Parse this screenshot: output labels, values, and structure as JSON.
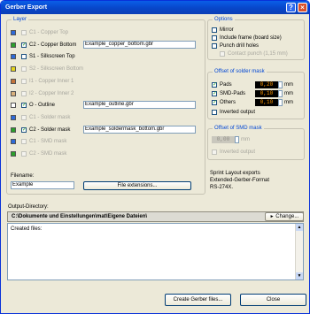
{
  "window": {
    "title": "Gerber Export"
  },
  "layer_group": {
    "label": "Layer",
    "layers": [
      {
        "color": "#2e6ad8",
        "name": "C1 - Copper Top",
        "checked": false,
        "enabled": false,
        "file": ""
      },
      {
        "color": "#2c9f2c",
        "name": "C2 - Copper Bottom",
        "checked": true,
        "enabled": true,
        "file": "Example_copper_bottom.gbr"
      },
      {
        "color": "#2e6ad8",
        "name": "S1 - Silkscreen Top",
        "checked": false,
        "enabled": true,
        "file": ""
      },
      {
        "color": "#e4d41c",
        "name": "S2 - Silkscreen Bottom",
        "checked": false,
        "enabled": false,
        "file": ""
      },
      {
        "color": "#c3733a",
        "name": "I1 - Copper Inner 1",
        "checked": false,
        "enabled": false,
        "file": ""
      },
      {
        "color": "#d8b07c",
        "name": "I2 - Copper Inner 2",
        "checked": false,
        "enabled": false,
        "file": ""
      },
      {
        "color": "#ffffff",
        "name": "O - Outline",
        "checked": true,
        "enabled": true,
        "file": "Example_outline.gbr"
      },
      {
        "color": "#2e6ad8",
        "name": "C1 - Solder mask",
        "checked": false,
        "enabled": false,
        "file": ""
      },
      {
        "color": "#2c9f2c",
        "name": "C2 - Solder mask",
        "checked": true,
        "enabled": true,
        "file": "Example_soldermask_bottom.gbr"
      },
      {
        "color": "#2e6ad8",
        "name": "C1 - SMD mask",
        "checked": false,
        "enabled": false,
        "file": ""
      },
      {
        "color": "#2c9f2c",
        "name": "C2 - SMD mask",
        "checked": false,
        "enabled": false,
        "file": ""
      }
    ],
    "filename_label": "Filename:",
    "filename_value": "Example",
    "file_extension_button": "File extensions..."
  },
  "options_group": {
    "label": "Options",
    "mirror": "Mirror",
    "include_frame": "Include frame (board size)",
    "punch_drill_holes": "Punch drill holes",
    "contact_punch": "Contact punch (1,15 mm)"
  },
  "solder_offset_group": {
    "label": "Offset of solder mask",
    "pads_label": "Pads",
    "pads_value": "0,20",
    "smd_pads_label": "SMD-Pads",
    "smd_pads_value": "0,10",
    "others_label": "Others",
    "others_value": "0,10",
    "unit": "mm",
    "inverted_output": "Inverted output"
  },
  "smd_offset_group": {
    "label": "Offset of SMD mask",
    "value": "0,00",
    "unit": "mm",
    "inverted_output": "Inverted output"
  },
  "info_text": [
    "Sprint Layout exports",
    "Extended-Gerber-Format",
    "RS-274X."
  ],
  "output": {
    "label": "Output-Directory:",
    "path": "C:\\Dokumente und Einstellungen\\mat\\Eigene Dateien\\",
    "change_button": "Change...",
    "created_files_label": "Created files:"
  },
  "footer": {
    "create_button": "Create Gerber files...",
    "close_button": "Close"
  }
}
